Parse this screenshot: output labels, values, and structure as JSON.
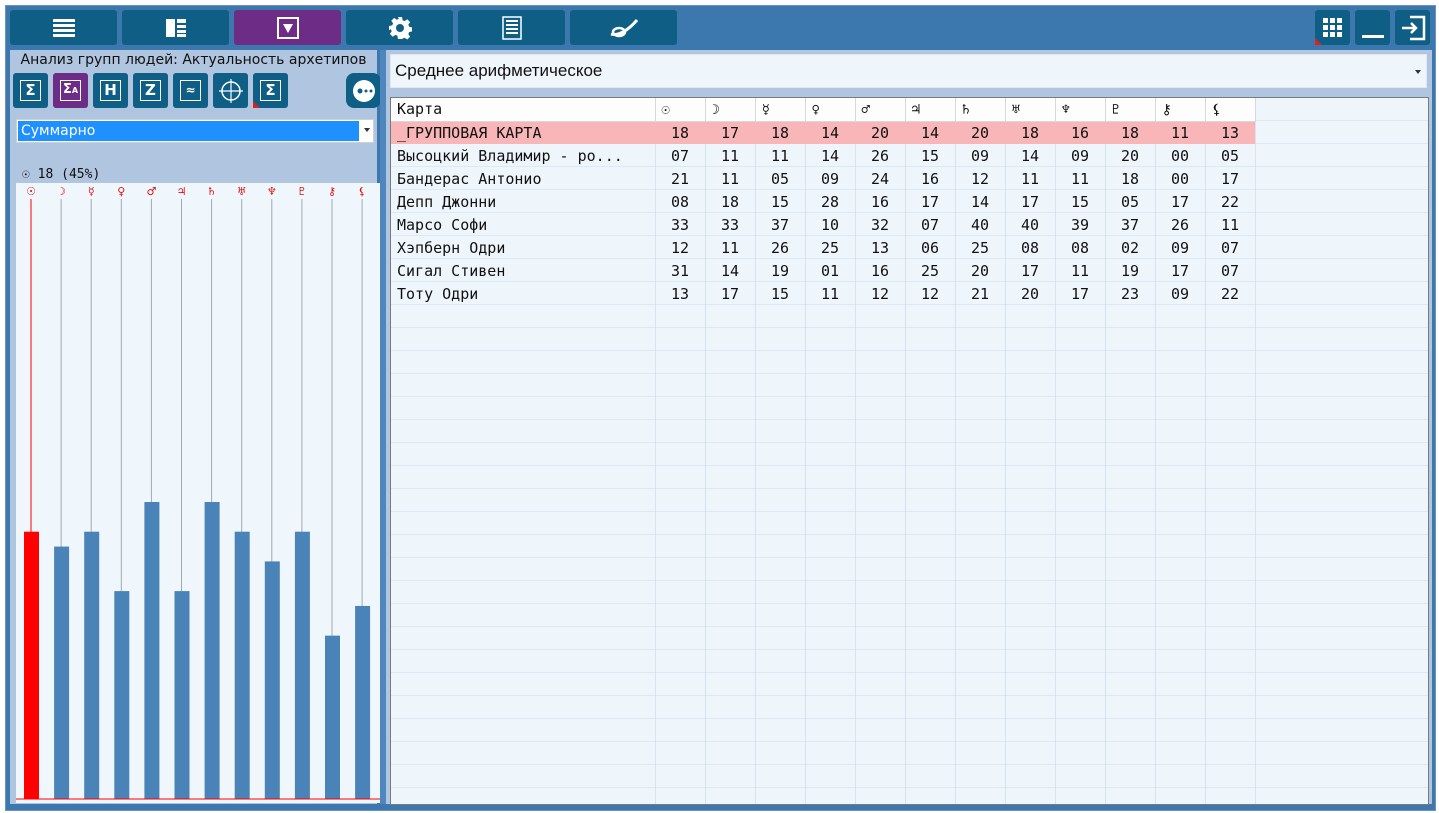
{
  "toolbar": {
    "buttons": [
      {
        "icon": "list-icon",
        "active": false
      },
      {
        "icon": "layout-icon",
        "active": false
      },
      {
        "icon": "triangle-down-icon",
        "active": true
      },
      {
        "icon": "gear-icon",
        "active": false
      },
      {
        "icon": "document-icon",
        "active": false
      },
      {
        "icon": "logo-icon",
        "active": false
      }
    ],
    "right_buttons": [
      "grid-menu-icon",
      "minimize-icon",
      "exit-icon"
    ]
  },
  "left_panel": {
    "title": "Анализ групп людей: Актуальность архетипов",
    "tool_buttons": [
      {
        "glyph": "Σ",
        "active": false
      },
      {
        "glyph": "ΣA",
        "active": true
      },
      {
        "glyph": "H",
        "active": false
      },
      {
        "glyph": "Z",
        "active": false
      },
      {
        "glyph": "wave",
        "active": false
      },
      {
        "glyph": "chart-wheel",
        "active": false
      },
      {
        "glyph": "Σ",
        "active": false
      }
    ],
    "mode_select": "Суммарно",
    "status": "☉ 18 (45%)"
  },
  "chart_data": {
    "type": "bar",
    "categories": [
      "☉",
      "☽",
      "☿",
      "♀",
      "♂",
      "♃",
      "♄",
      "♅",
      "♆",
      "♇",
      "⚷",
      "⚸"
    ],
    "values": [
      18,
      17,
      18,
      14,
      20,
      14,
      20,
      18,
      16,
      18,
      11,
      13
    ],
    "ylim": [
      0,
      40
    ],
    "highlight_index": 0,
    "colors": {
      "bar": "#4a83b7",
      "highlight": "#ff0000",
      "glyph": "#e01010"
    }
  },
  "right_panel": {
    "mode_select": "Среднее арифметическое",
    "table": {
      "header_name": "Карта",
      "planets": [
        "☉",
        "☽",
        "☿",
        "♀",
        "♂",
        "♃",
        "♄",
        "♅",
        "♆",
        "♇",
        "⚷",
        "⚸"
      ],
      "rows": [
        {
          "name": "_ГРУППОВАЯ КАРТА",
          "values": [
            "18",
            "17",
            "18",
            "14",
            "20",
            "14",
            "20",
            "18",
            "16",
            "18",
            "11",
            "13"
          ],
          "group": true
        },
        {
          "name": "Высоцкий Владимир - ро...",
          "values": [
            "07",
            "11",
            "11",
            "14",
            "26",
            "15",
            "09",
            "14",
            "09",
            "20",
            "00",
            "05"
          ]
        },
        {
          "name": "Бандерас Антонио",
          "values": [
            "21",
            "11",
            "05",
            "09",
            "24",
            "16",
            "12",
            "11",
            "11",
            "18",
            "00",
            "17"
          ]
        },
        {
          "name": "Депп Джонни",
          "values": [
            "08",
            "18",
            "15",
            "28",
            "16",
            "17",
            "14",
            "17",
            "15",
            "05",
            "17",
            "22"
          ]
        },
        {
          "name": "Марсо Софи",
          "values": [
            "33",
            "33",
            "37",
            "10",
            "32",
            "07",
            "40",
            "40",
            "39",
            "37",
            "26",
            "11"
          ]
        },
        {
          "name": "Хэпберн Одри",
          "values": [
            "12",
            "11",
            "26",
            "25",
            "13",
            "06",
            "25",
            "08",
            "08",
            "02",
            "09",
            "07"
          ]
        },
        {
          "name": "Сигал Стивен",
          "values": [
            "31",
            "14",
            "19",
            "01",
            "16",
            "25",
            "20",
            "17",
            "11",
            "19",
            "17",
            "07"
          ]
        },
        {
          "name": "Тоту Одри",
          "values": [
            "13",
            "17",
            "15",
            "11",
            "12",
            "12",
            "21",
            "20",
            "17",
            "23",
            "09",
            "22"
          ]
        }
      ]
    }
  }
}
